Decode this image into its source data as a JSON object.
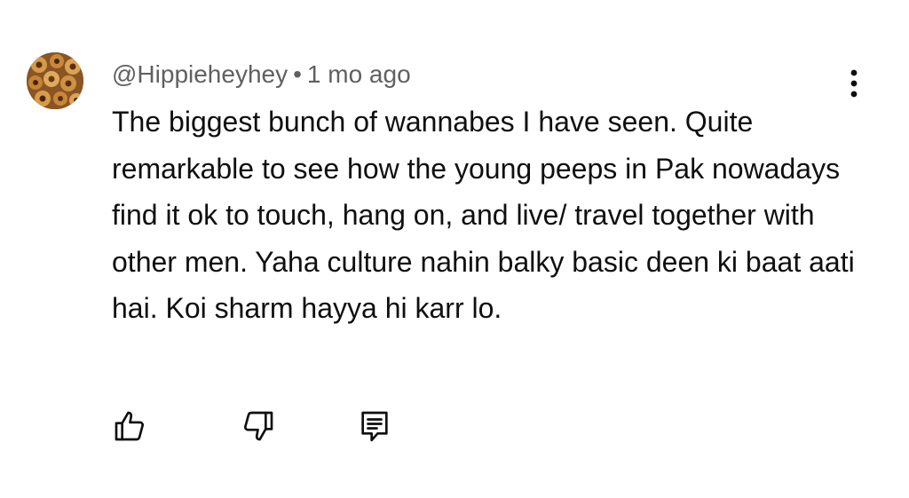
{
  "comment": {
    "author": "@Hippieheyhey",
    "separator": "•",
    "time": "1 mo ago",
    "text": "The biggest bunch of wannabes I have seen. Quite remarkable to see how the young peeps in Pak nowadays find it ok to touch, hang on, and live/ travel together with other men. Yaha culture nahin balky basic deen ki baat aati hai. Koi sharm hayya hi karr lo."
  },
  "icons": {
    "avatar": "avatar-image",
    "more": "more-vert-icon",
    "like": "thumbs-up-icon",
    "dislike": "thumbs-down-icon",
    "reply": "reply-comment-icon"
  },
  "colors": {
    "text": "#0f0f0f",
    "meta": "#606060",
    "background": "#ffffff"
  }
}
